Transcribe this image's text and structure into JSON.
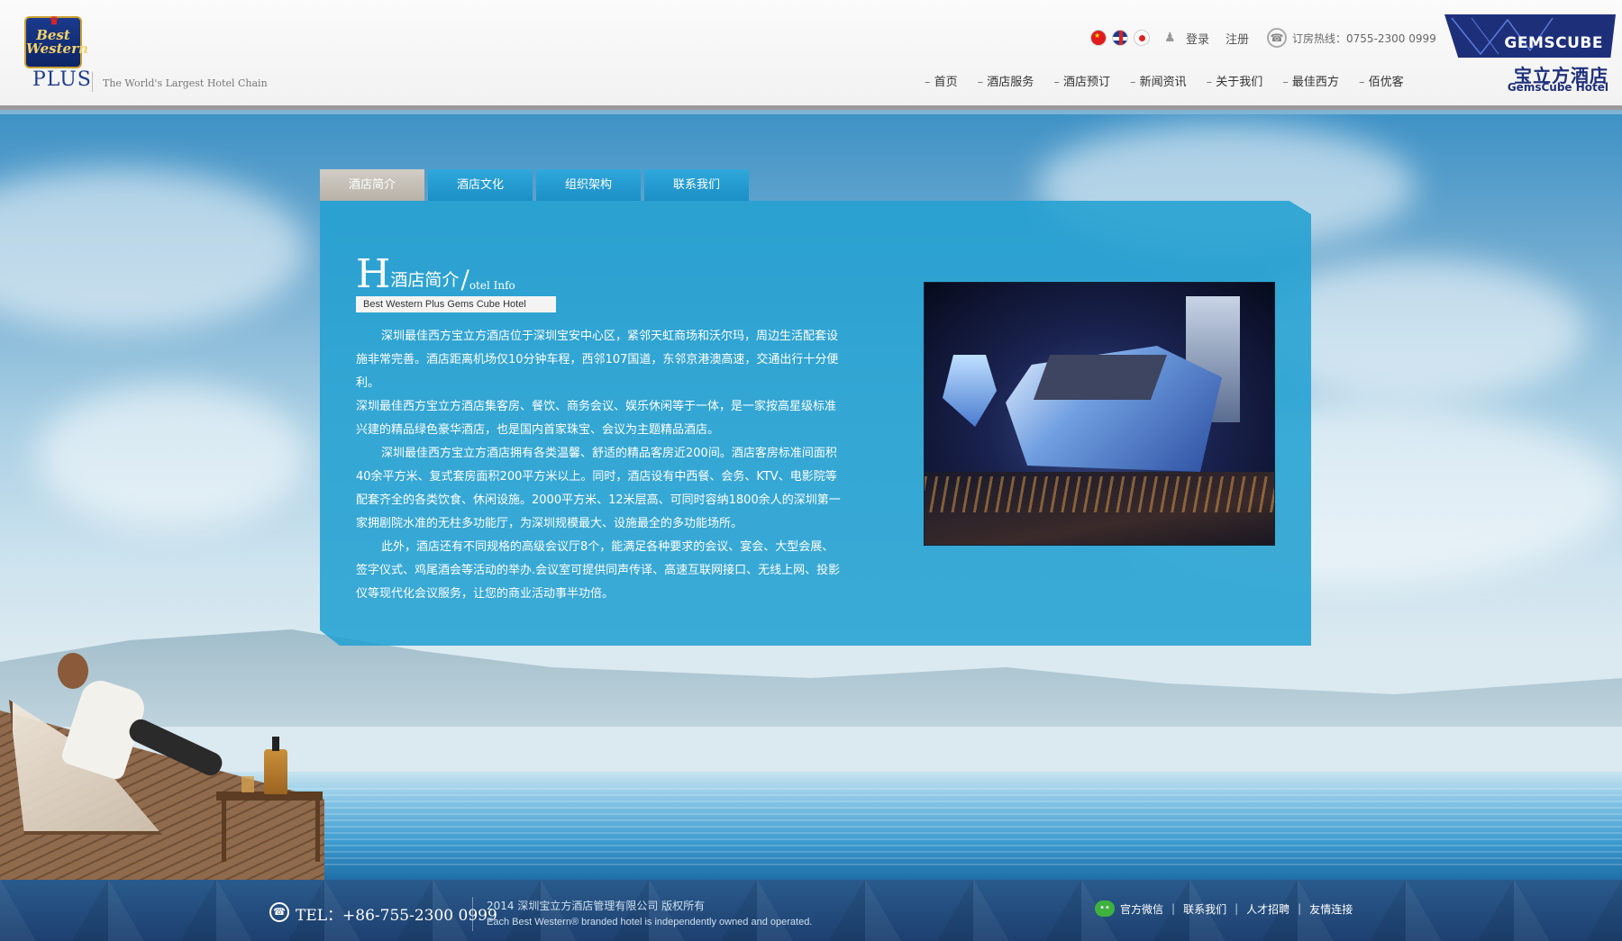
{
  "header": {
    "logo_text": "Best Western",
    "logo_plus": "PLUS",
    "tagline": "The World's Largest Hotel Chain",
    "login": "登录",
    "register": "注册",
    "hotline": "订房热线：0755-2300 0999",
    "nav": [
      "首页",
      "酒店服务",
      "酒店预订",
      "新闻资讯",
      "关于我们",
      "最佳西方",
      "佰优客"
    ],
    "gems_word": "GEMSCUBE",
    "gems_cn": "宝立方酒店",
    "gems_en": "GemsCube Hotel"
  },
  "tabs": [
    "酒店简介",
    "酒店文化",
    "组织架构",
    "联系我们"
  ],
  "panel": {
    "title_big": "H",
    "title_cn": "酒店简介",
    "title_slash": "/",
    "title_en": "otel Info",
    "subtitle": "Best Western Plus Gems Cube Hotel",
    "paragraphs": [
      "深圳最佳西方宝立方酒店位于深圳宝安中心区，紧邻天虹商场和沃尔玛，周边生活配套设施非常完善。酒店距离机场仅10分钟车程，西邻107国道，东邻京港澳高速，交通出行十分便利。",
      "深圳最佳西方宝立方酒店集客房、餐饮、商务会议、娱乐休闲等于一体，是一家按高星级标准兴建的精品绿色豪华酒店，也是国内首家珠宝、会议为主题精品酒店。",
      "深圳最佳西方宝立方酒店拥有各类温馨、舒适的精品客房近200间。酒店客房标准间面积40余平方米、复式套房面积200平方米以上。同时，酒店设有中西餐、会务、KTV、电影院等配套齐全的各类饮食、休闲设施。2000平方米、12米层高、可同时容纳1800余人的深圳第一家拥剧院水准的无柱多功能厅，为深圳规模最大、设施最全的多功能场所。",
      "此外，酒店还有不同规格的高级会议厅8个，能满足各种要求的会议、宴会、大型会展、签字仪式、鸡尾酒会等活动的举办.会议室可提供同声传译、高速互联网接口、无线上网、投影仪等现代化会议服务，让您的商业活动事半功倍。"
    ]
  },
  "footer": {
    "tel": "TEL：+86-755-2300 0999",
    "copyright": "2014 深圳宝立方酒店管理有限公司 版权所有",
    "disclaimer": "Each Best Western® branded hotel is independently owned and operated.",
    "links": [
      "官方微信",
      "联系我们",
      "人才招聘",
      "友情连接"
    ],
    "separator": "|"
  },
  "icons": {
    "flag_cn": "china-flag-icon",
    "flag_uk": "uk-flag-icon",
    "flag_jp": "japan-flag-icon",
    "user": "user-icon",
    "phone": "phone-icon",
    "wechat": "wechat-icon"
  },
  "colors": {
    "brand_blue": "#1e2f7a",
    "panel_blue": "#23a0d2",
    "tab_active": "#b8b2a8",
    "footer_bg": "#1d4070"
  }
}
